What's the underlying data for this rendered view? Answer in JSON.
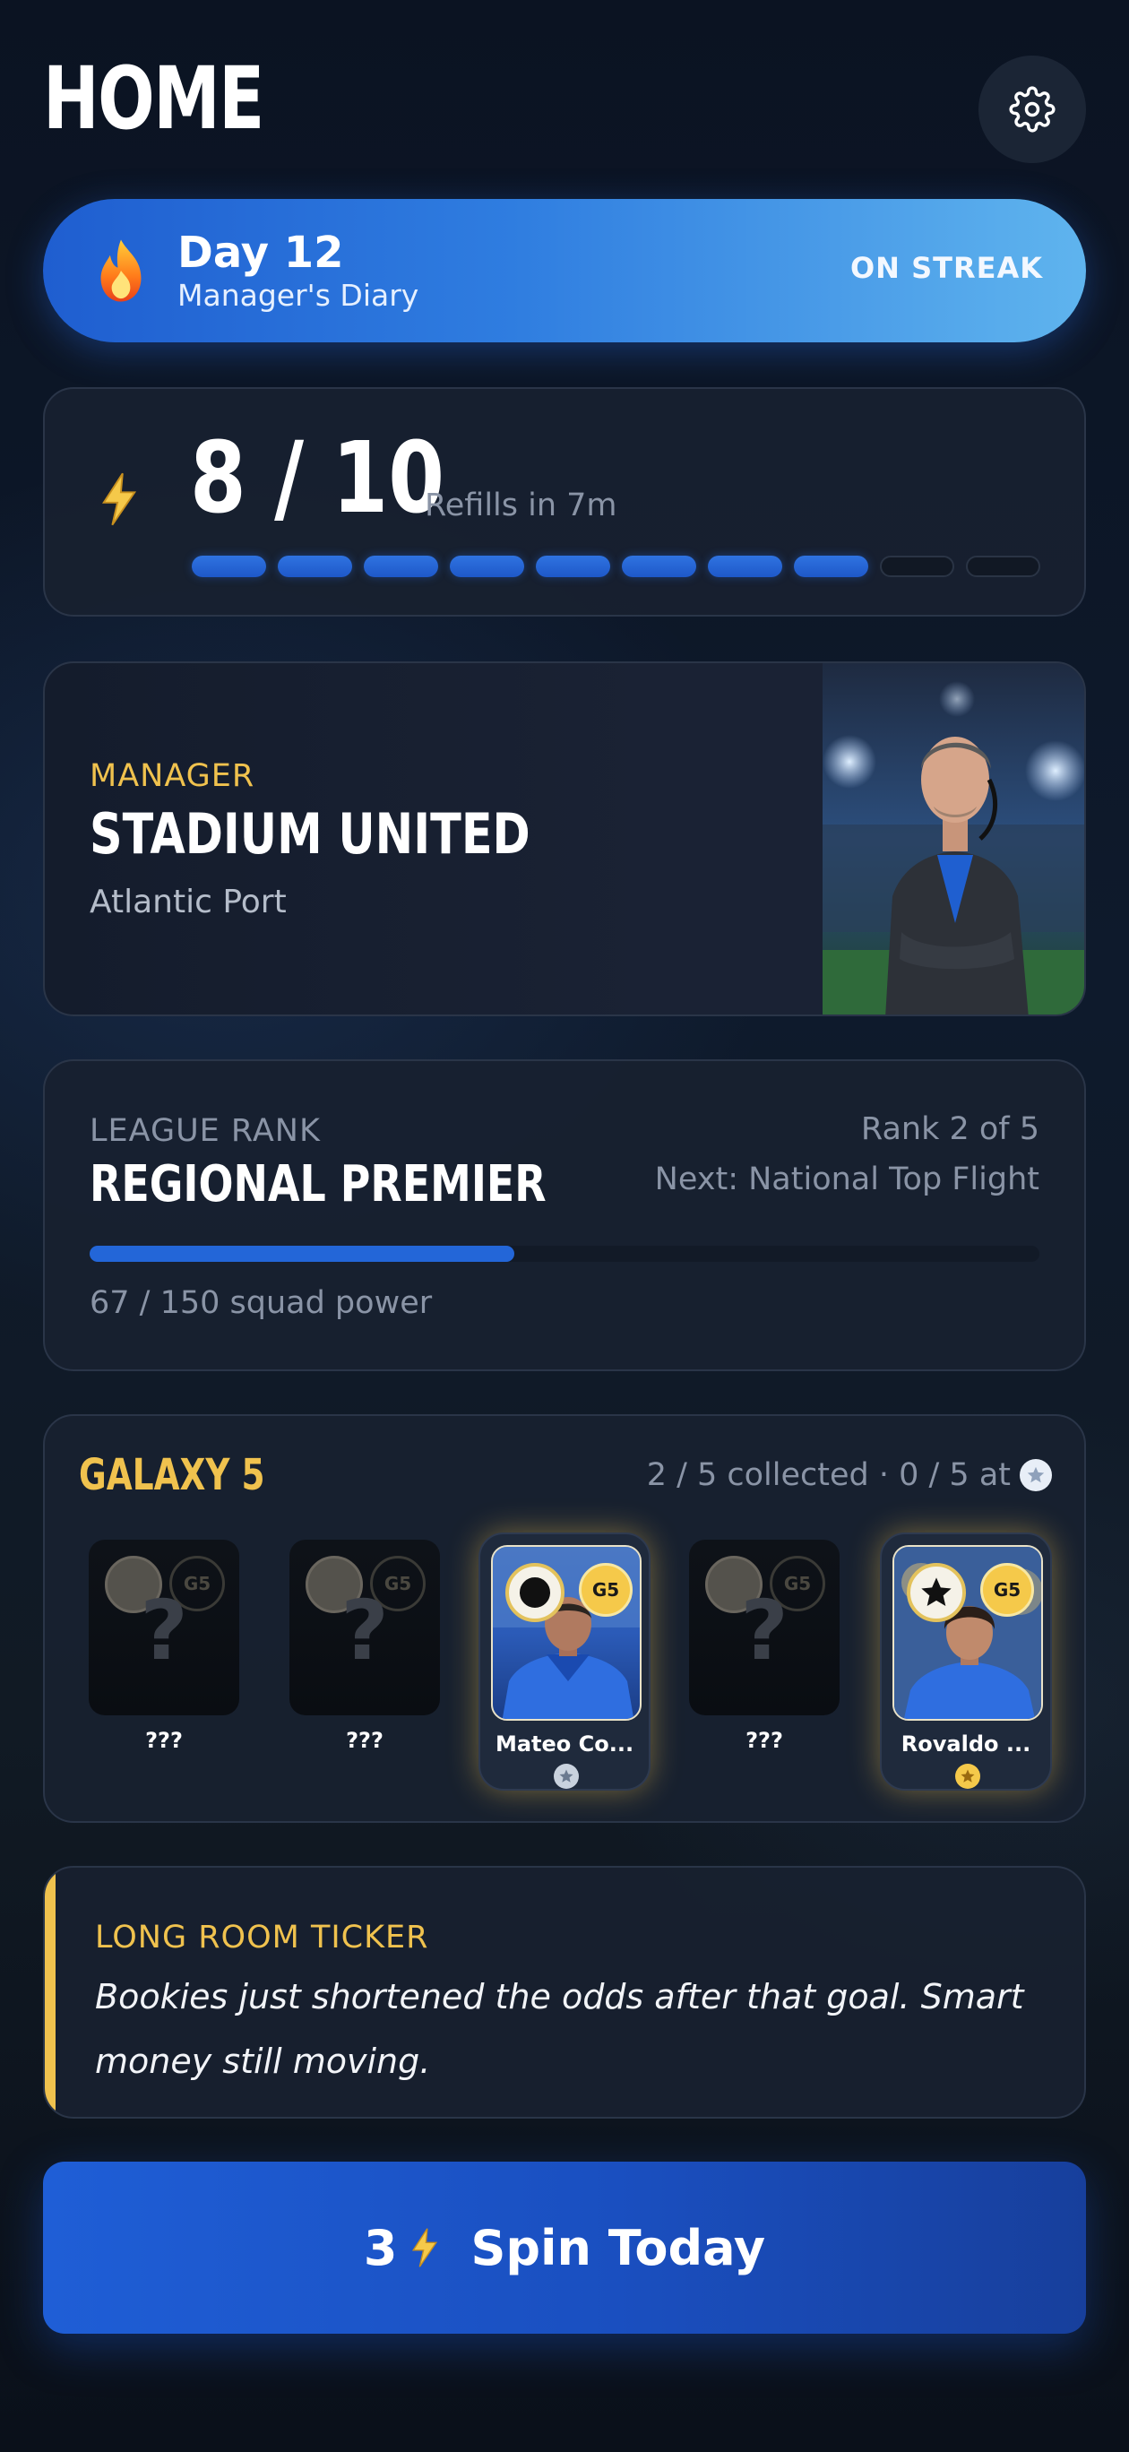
{
  "header": {
    "title": "HOME"
  },
  "streak": {
    "day": "Day 12",
    "subtitle": "Manager's Diary",
    "status": "ON STREAK"
  },
  "energy": {
    "count": "8 / 10",
    "refill": "Refills in 7m",
    "filled": 8,
    "total": 10
  },
  "manager": {
    "label": "MANAGER",
    "team": "STADIUM UNITED",
    "city": "Atlantic Port"
  },
  "league": {
    "label": "LEAGUE RANK",
    "name": "REGIONAL PREMIER",
    "rank": "Rank 2 of 5",
    "next": "Next: National Top Flight",
    "power_text": "67 / 150 squad power",
    "power": 67,
    "power_max": 150
  },
  "galaxy": {
    "title": "GALAXY 5",
    "count": "2 / 5 collected · 0 / 5 at",
    "slots": [
      {
        "name": "???",
        "owned": false,
        "rating": "G5"
      },
      {
        "name": "???",
        "owned": false,
        "rating": "G5"
      },
      {
        "name": "Mateo Co...",
        "owned": true,
        "rating": "G5",
        "tier": "silver"
      },
      {
        "name": "???",
        "owned": false,
        "rating": "G5"
      },
      {
        "name": "Rovaldo ...",
        "owned": true,
        "rating": "G5",
        "tier": "gold"
      }
    ]
  },
  "ticker": {
    "label": "LONG ROOM TICKER",
    "text": "Bookies just shortened the odds after that goal. Smart money still moving."
  },
  "spin": {
    "cost": "3",
    "label": "Spin Today"
  },
  "colors": {
    "accent_gold": "#f0c24e",
    "accent_blue": "#2366d8"
  },
  "icons": {
    "settings": "gear-icon",
    "streak": "flame-icon",
    "energy": "bolt-icon"
  }
}
